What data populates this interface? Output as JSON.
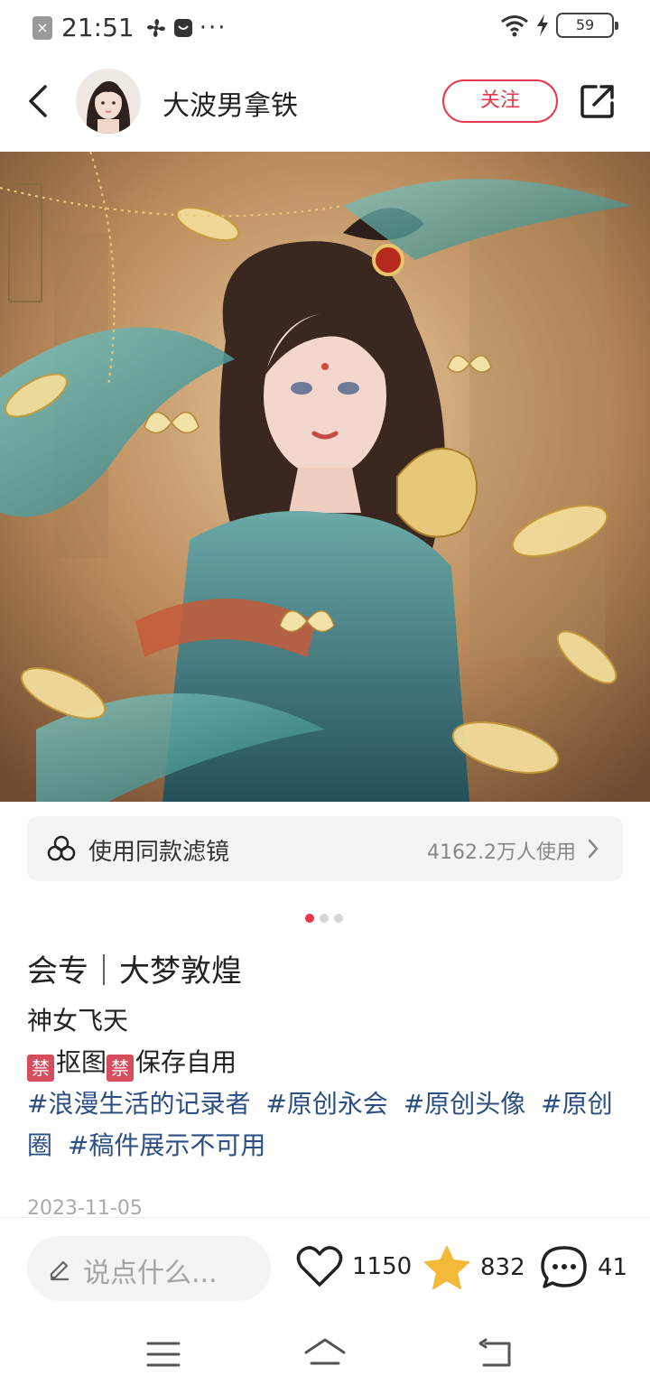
{
  "status_bar": {
    "time": "21:51",
    "more": "···",
    "battery": "59",
    "icons": [
      "close-notification-icon",
      "fan-icon",
      "app-icon",
      "wifi-icon",
      "charging-icon",
      "battery-icon"
    ]
  },
  "header": {
    "username": "大波男拿铁",
    "follow_label": "关注",
    "accent": "#e8364b"
  },
  "post": {
    "filter_label": "使用同款滤镜",
    "filter_count": "4162.2万人使用",
    "page_count": 3,
    "page_current": 1,
    "title": "会专｜大梦敦煌",
    "line1": "神女飞天",
    "ban_glyph": "禁",
    "line2_a": "抠图",
    "line2_b": "保存自用",
    "tags": [
      "#浪漫生活的记录者",
      "#原创永会",
      "#原创头像",
      "#原创圈",
      "#稿件展示不可用"
    ],
    "date": "2023-11-05"
  },
  "bottom_bar": {
    "comment_placeholder": "说点什么...",
    "likes": "1150",
    "favorites": "832",
    "comments": "41"
  },
  "nav": {
    "icons": [
      "menu-icon",
      "home-icon",
      "back-nav-icon"
    ]
  }
}
